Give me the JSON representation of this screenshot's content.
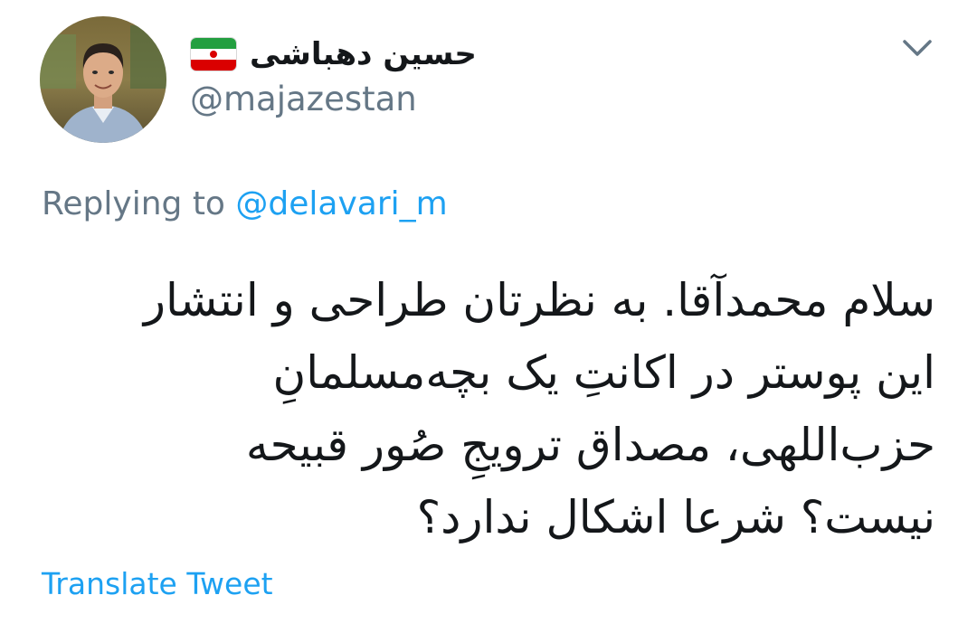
{
  "tweet": {
    "author": {
      "display_name": "حسین دهباشی",
      "handle": "@majazestan",
      "avatar_icon": "profile-photo",
      "badge_icon": "iran-flag-icon"
    },
    "menu_icon": "chevron-down-icon",
    "reply_context": {
      "prefix": "Replying to",
      "mention": "@delavari_m"
    },
    "text_lines": [
      "سلام محمدآقا. به نظرتان طراحی و انتشار",
      "این پوستر در اکانتِ یک بچه‌مسلمانِ",
      "حزب‌اللهی، مصداق ترویجِ صُور قبیحه",
      "نیست؟ شرعا اشکال ندارد؟"
    ],
    "translate_label": "Translate Tweet"
  },
  "colors": {
    "text_primary": "#14171a",
    "text_secondary": "#657786",
    "link": "#1da1f2",
    "background": "#ffffff"
  }
}
